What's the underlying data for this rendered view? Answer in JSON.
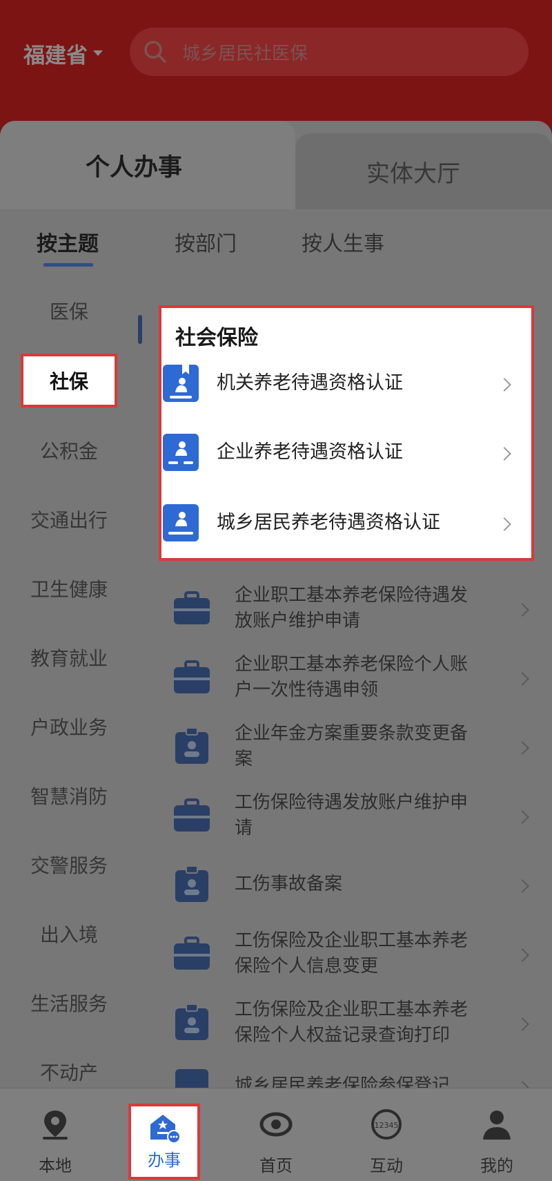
{
  "header": {
    "province": "福建省",
    "search_placeholder": "城乡居民社医保"
  },
  "tabs": {
    "main": "个人办事",
    "other": "实体大厅"
  },
  "subtabs": [
    "按主题",
    "按部门",
    "按人生事"
  ],
  "sidebar": {
    "items": [
      "医保",
      "社保",
      "公积金",
      "交通出行",
      "卫生健康",
      "教育就业",
      "户政业务",
      "智慧消防",
      "交警服务",
      "出入境",
      "生活服务",
      "不动产"
    ],
    "active": "社保"
  },
  "section_title": "社会保险",
  "highlighted_services": [
    "机关养老待遇资格认证",
    "企业养老待遇资格认证",
    "城乡居民养老待遇资格认证"
  ],
  "services": [
    {
      "line1": "企业职工基本养老保险待遇发",
      "line2": "放账户维护申请",
      "icon": "briefcase-icon"
    },
    {
      "line1": "企业职工基本养老保险个人账",
      "line2": "户一次性待遇申领",
      "icon": "briefcase-icon"
    },
    {
      "line1": "企业年金方案重要条款变更备",
      "line2": "案",
      "icon": "id-badge-icon"
    },
    {
      "line1": "工伤保险待遇发放账户维护申",
      "line2": "请",
      "icon": "briefcase-icon"
    },
    {
      "line1": "工伤事故备案",
      "line2": "",
      "icon": "id-badge-icon"
    },
    {
      "line1": "工伤保险及企业职工基本养老",
      "line2": "保险个人信息变更",
      "icon": "briefcase-icon"
    },
    {
      "line1": "工伤保险及企业职工基本养老",
      "line2": "保险个人权益记录查询打印",
      "icon": "id-badge-icon"
    },
    {
      "line1": "城乡居民养老保险参保登记",
      "line2": "",
      "icon": "document-icon"
    }
  ],
  "bottom_nav": [
    {
      "label": "本地",
      "icon": "location-icon"
    },
    {
      "label": "办事",
      "icon": "service-hall-icon"
    },
    {
      "label": "首页",
      "icon": "home-logo-icon"
    },
    {
      "label": "互动",
      "icon": "hotline-12345-icon"
    },
    {
      "label": "我的",
      "icon": "user-icon"
    }
  ],
  "nav_active": "办事",
  "colors": {
    "header_bg": "#7c1414",
    "highlight_border": "#d83a3a",
    "icon_blue": "#2e6ad4",
    "active_nav_text": "#2e6ad4"
  }
}
